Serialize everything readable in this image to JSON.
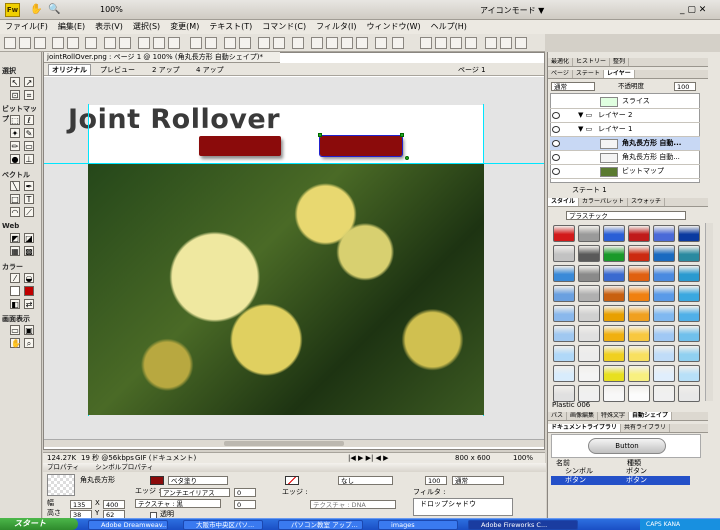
{
  "app": {
    "logo": "Fw",
    "zoom": "100%",
    "mode": "アイコンモード ▼"
  },
  "menu": [
    "ファイル(F)",
    "編集(E)",
    "表示(V)",
    "選択(S)",
    "変更(M)",
    "テキスト(T)",
    "コマンド(C)",
    "フィルタ(I)",
    "ウィンドウ(W)",
    "ヘルプ(H)"
  ],
  "document": {
    "tab": "jointRollOver.png : ページ 1 @ 100% (角丸長方形 自動シェイプ)*",
    "views": [
      "オリジナル",
      "プレビュー",
      "2 アップ",
      "4 アップ"
    ],
    "page_label": "ページ 1",
    "heading": "Joint Rollover"
  },
  "tools": {
    "sections": [
      "選択",
      "ビットマップ",
      "ベクトル",
      "Web",
      "カラー",
      "画面表示"
    ]
  },
  "status": {
    "size": "124.27K",
    "time": "19 秒 @56kbps",
    "format": "GIF (ドキュメント)",
    "dims": "800 x 600",
    "zoom": "100%"
  },
  "props": {
    "tabs": [
      "プロパティ",
      "シンボルプロパティ"
    ],
    "name": "角丸長方形",
    "fill": "ベタ塗り",
    "edge": "アンチエイリアス",
    "edge_val": "0",
    "texture": "テクスチャ : 黒",
    "texture_val": "0",
    "alpha": "透明",
    "w_label": "幅",
    "w": "135",
    "x_label": "X",
    "x": "400",
    "h_label": "高さ",
    "h": "38",
    "y_label": "Y",
    "y": "62",
    "stroke": "なし",
    "stroke_edge": "エッジ :",
    "stroke_texture": "テクスチャ : DNA",
    "opacity": "100",
    "blend": "通常",
    "filter_label": "フィルタ :",
    "filter": "ドロップシャドウ"
  },
  "layers": {
    "tabs": [
      "最適化",
      "ヒストリー",
      "整列"
    ],
    "tabs2": [
      "ページ",
      "ステート",
      "レイヤー"
    ],
    "blend": "通常",
    "opacity_label": "不透明度",
    "opacity": "100",
    "rows": [
      "スライス",
      "レイヤー 2",
      "レイヤー 1",
      "角丸長方形 自動...",
      "角丸長方形 自動...",
      "ビットマップ"
    ],
    "state": "ステート 1"
  },
  "styles": {
    "tabs": [
      "スタイル",
      "カラーパレット",
      "スウォッチ"
    ],
    "set": "プラスチック",
    "caption": "Plastic 006",
    "colors": [
      "#d21a1a",
      "#9a9a9a",
      "#2a5fd6",
      "#c01a1a",
      "#4a6ad8",
      "#0a3aa0",
      "#c2c2c2",
      "#5a5a5a",
      "#1a9a2a",
      "#cc2a10",
      "#1a6ac0",
      "#2a8aa0",
      "#3a8ad8",
      "#8a8a8a",
      "#3a6ad0",
      "#e06010",
      "#4a8ae0",
      "#2a9ad0",
      "#6aa0e0",
      "#b0b0b0",
      "#c86010",
      "#f08010",
      "#5a9ae8",
      "#3aa8e0",
      "#8ab8ec",
      "#d0d0d0",
      "#e8a000",
      "#f0a020",
      "#80b8f0",
      "#50b0e8",
      "#a0c8f0",
      "#e0e0e0",
      "#f0b010",
      "#f8c840",
      "#a0c8f4",
      "#70c0ec",
      "#b0d8f8",
      "#ececec",
      "#f0d020",
      "#f8e060",
      "#c0dcf8",
      "#90d0f0",
      "#d8ecfc",
      "#f4f4f4",
      "#e8e020",
      "#f8f080",
      "#e0eefc",
      "#b8e0f8",
      "#e0e0e0",
      "#f0f0f0",
      "#f8f8f8",
      "#fcfcfc",
      "#f0f0f0",
      "#e8e8e8"
    ]
  },
  "library": {
    "tabs": [
      "パス",
      "画像編集",
      "特殊文字",
      "自動シェイプ"
    ],
    "tabs2": [
      "ドキュメントライブラリ",
      "共有ライブラリ"
    ],
    "preview_btn": "Button",
    "cols": [
      "名前",
      "種類"
    ],
    "items": [
      {
        "name": "シンボル",
        "type": "ボタン"
      },
      {
        "name": "ボタン",
        "type": "ボタン"
      }
    ]
  },
  "taskbar": {
    "start": "スタート",
    "tasks": [
      "Adobe Dreamweav...",
      "大阪市中央区パソ...",
      "パソコン教室 アップ...",
      "images",
      "Adobe Fireworks C..."
    ],
    "clock": "CAPS KANA"
  }
}
